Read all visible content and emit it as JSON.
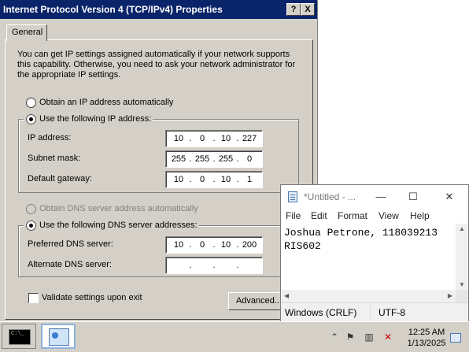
{
  "dialog": {
    "title": "Internet Protocol Version 4 (TCP/IPv4) Properties",
    "help_label": "?",
    "close_label": "X",
    "tab_general": "General",
    "intro": "You can get IP settings assigned automatically if your network supports this capability. Otherwise, you need to ask your network administrator for the appropriate IP settings.",
    "ip_auto_label": "Obtain an IP address automatically",
    "ip_manual_label": "Use the following IP address:",
    "ip_mode": "manual",
    "ip_address_label": "IP address:",
    "ip_address": [
      "10",
      "0",
      "10",
      "227"
    ],
    "subnet_label": "Subnet mask:",
    "subnet": [
      "255",
      "255",
      "255",
      "0"
    ],
    "gateway_label": "Default gateway:",
    "gateway": [
      "10",
      "0",
      "10",
      "1"
    ],
    "dns_auto_label": "Obtain DNS server address automatically",
    "dns_manual_label": "Use the following DNS server addresses:",
    "dns_mode": "manual",
    "preferred_dns_label": "Preferred DNS server:",
    "preferred_dns": [
      "10",
      "0",
      "10",
      "200"
    ],
    "alternate_dns_label": "Alternate DNS server:",
    "alternate_dns": [
      "",
      "",
      "",
      ""
    ],
    "dot": ".",
    "validate_label": "Validate settings upon exit",
    "validate_checked": false,
    "advanced_label": "Advanced..."
  },
  "notepad": {
    "title": "*Untitled - ...",
    "menu": [
      "File",
      "Edit",
      "Format",
      "View",
      "Help"
    ],
    "text_lines": [
      "Joshua Petrone, 118039213",
      "RIS602"
    ],
    "status_line_ending": "Windows (CRLF)",
    "status_encoding": "UTF-8",
    "minimize_glyph": "—",
    "maximize_glyph": "☐",
    "close_glyph": "✕"
  },
  "taskbar": {
    "cmd_icon_text": "C:\\_",
    "time": "12:25 AM",
    "date": "1/13/2025",
    "tray_icons": [
      "chevron-up-icon",
      "flag-icon",
      "network-icon",
      "volume-muted-icon"
    ]
  },
  "colors": {
    "titlebar": "#0a246a",
    "dialog_bg": "#d4d0c8"
  }
}
